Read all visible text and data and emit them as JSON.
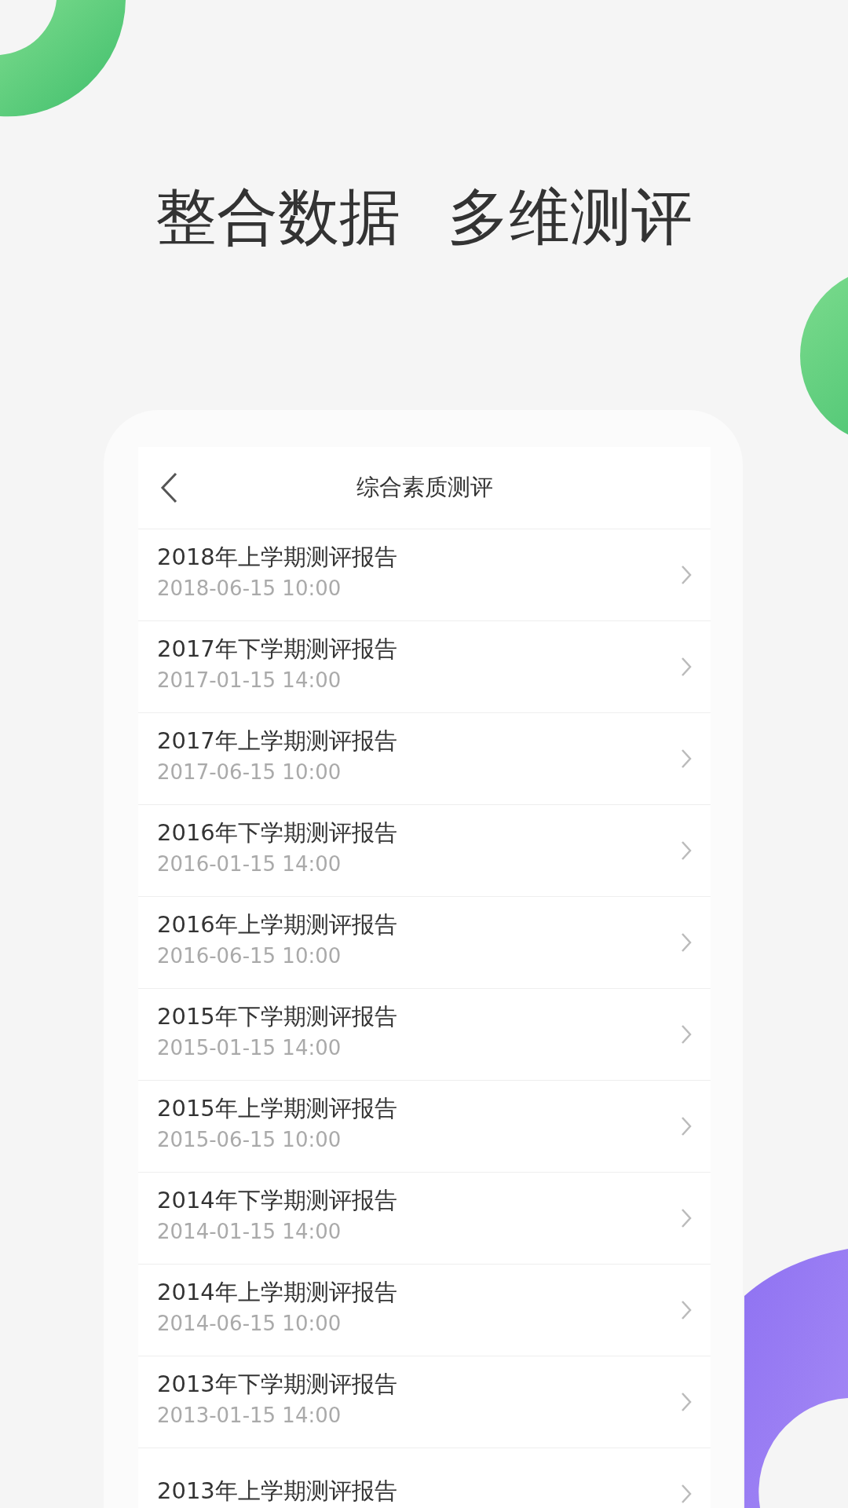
{
  "headline": [
    "整合数据",
    "多维测评"
  ],
  "screen": {
    "title": "综合素质测评",
    "reports": [
      {
        "title": "2018年上学期测评报告",
        "time": "2018-06-15 10:00"
      },
      {
        "title": "2017年下学期测评报告",
        "time": "2017-01-15 14:00"
      },
      {
        "title": "2017年上学期测评报告",
        "time": "2017-06-15 10:00"
      },
      {
        "title": "2016年下学期测评报告",
        "time": "2016-01-15 14:00"
      },
      {
        "title": "2016年上学期测评报告",
        "time": "2016-06-15 10:00"
      },
      {
        "title": "2015年下学期测评报告",
        "time": "2015-01-15 14:00"
      },
      {
        "title": "2015年上学期测评报告",
        "time": "2015-06-15 10:00"
      },
      {
        "title": "2014年下学期测评报告",
        "time": "2014-01-15 14:00"
      },
      {
        "title": "2014年上学期测评报告",
        "time": "2014-06-15 10:00"
      },
      {
        "title": "2013年下学期测评报告",
        "time": "2013-01-15 14:00"
      },
      {
        "title": "2013年上学期测评报告"
      }
    ]
  }
}
